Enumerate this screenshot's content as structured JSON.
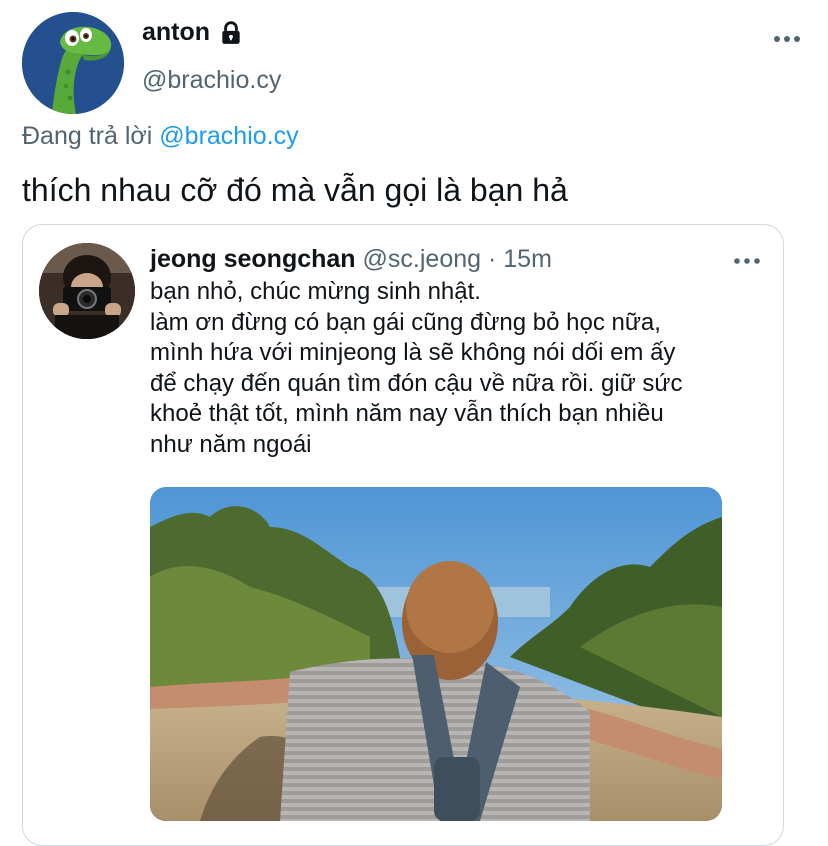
{
  "author": {
    "display_name": "anton",
    "handle": "@brachio.cy",
    "protected": true,
    "avatar": "green-dinosaur-avatar"
  },
  "reply": {
    "prefix": "Đang trả lời",
    "mention": "@brachio.cy"
  },
  "tweet_text": "thích nhau cỡ đó mà vẫn gọi là bạn hả",
  "quoted_tweet": {
    "display_name": "jeong seongchan",
    "handle": "@sc.jeong",
    "separator": "·",
    "time": "15m",
    "lines": [
      "bạn nhỏ, chúc mừng sinh nhật.",
      "làm ơn đừng có bạn gái cũng đừng bỏ học nữa,",
      "mình hứa với minjeong là sẽ không nói dối em ấy",
      "để chạy đến quán tìm đón cậu về nữa rồi. giữ sức",
      "khoẻ thật tốt, mình năm nay vẫn thích bạn nhiều",
      "như năm ngoái"
    ],
    "photo": "person-with-backpack-arms-outstretched-photo"
  },
  "colors": {
    "text": "#0f1419",
    "secondary": "#536471",
    "link": "#1d9bf0",
    "border": "#cfd9de"
  }
}
